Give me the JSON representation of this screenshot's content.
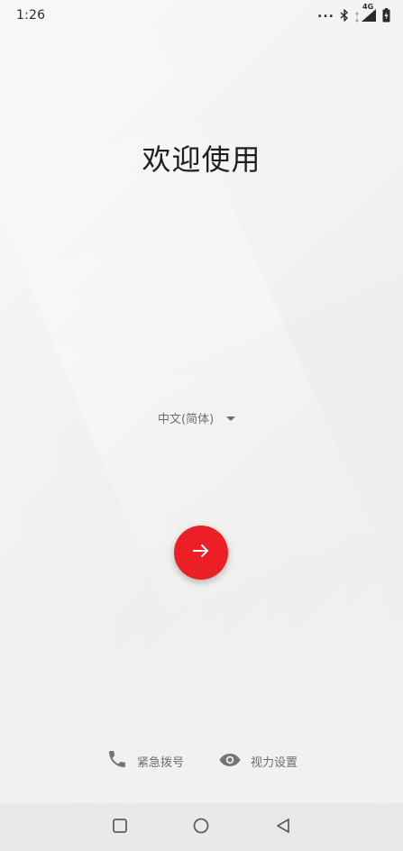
{
  "status_bar": {
    "time": "1:26",
    "overflow_indicator": "...",
    "network_label": "4G",
    "icons": [
      "bluetooth-icon",
      "data-arrows-icon",
      "signal-icon",
      "battery-charging-icon"
    ]
  },
  "welcome": {
    "title": "欢迎使用"
  },
  "language": {
    "selected": "中文(简体)"
  },
  "next_button": {
    "icon": "arrow-right-icon",
    "color": "#eb1f25"
  },
  "bottom_actions": {
    "emergency": {
      "label": "紧急拨号",
      "icon": "phone-icon"
    },
    "vision": {
      "label": "视力设置",
      "icon": "eye-icon"
    }
  },
  "nav_bar": {
    "buttons": [
      "recents-square-icon",
      "home-circle-icon",
      "back-triangle-icon"
    ]
  },
  "colors": {
    "accent": "#eb1f25",
    "text_primary": "#1f1f1f",
    "text_secondary": "#6e6e6e",
    "nav_background": "#e9eae8"
  }
}
